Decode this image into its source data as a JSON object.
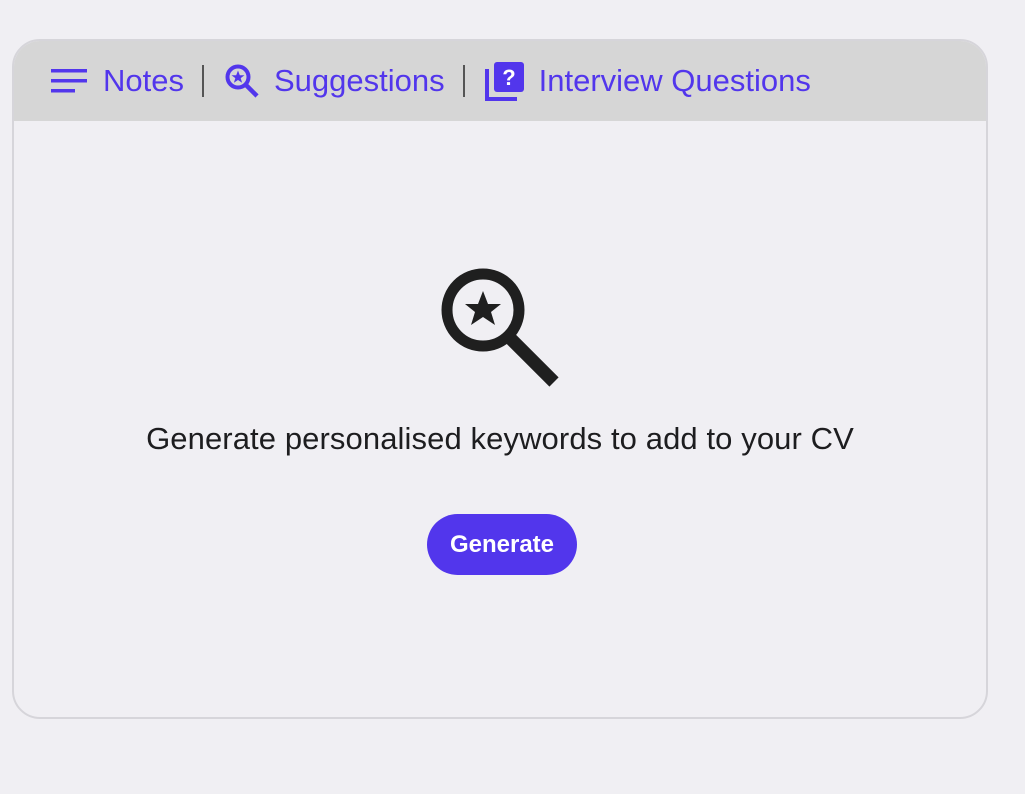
{
  "tabs": [
    {
      "label": "Notes",
      "icon": "notes-lines-icon"
    },
    {
      "label": "Suggestions",
      "icon": "magnify-star-icon"
    },
    {
      "label": "Interview Questions",
      "icon": "question-stack-icon"
    }
  ],
  "main": {
    "hero_icon": "magnify-star-icon",
    "message": "Generate personalised keywords to add to your CV",
    "generate_label": "Generate"
  },
  "colors": {
    "accent": "#5236ec",
    "tabbar_bg": "#d6d6d6",
    "page_bg": "#f0eff3"
  }
}
